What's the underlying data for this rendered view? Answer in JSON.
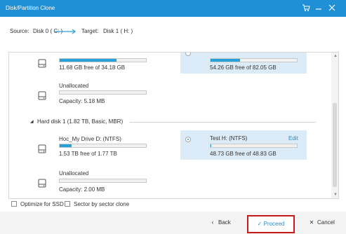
{
  "window": {
    "title": "Disk/Partition Clone",
    "controls": [
      "cart-icon",
      "minimize-icon",
      "close-icon"
    ]
  },
  "source_target": {
    "source_label": "Source:",
    "source_value": "Disk 0 ( C: )",
    "target_label": "Target:",
    "target_value": "Disk 1 ( H: )"
  },
  "disk0": {
    "partitions": [
      {
        "free_text": "11.68 GB free of 34.18 GB",
        "fill_pct": 66
      },
      {
        "name": "Unallocated",
        "capacity": "Capacity: 5.18 MB",
        "fill_pct": 0
      }
    ],
    "target_partial": {
      "free_text": "54.26 GB free of 82.05 GB",
      "fill_pct": 34
    }
  },
  "disk1": {
    "header": "Hard disk 1 (1.82 TB, Basic, MBR)",
    "partitions": [
      {
        "name": "Hoc_My Drive D: (NTFS)",
        "free_text": "1.53 TB free of 1.77 TB",
        "fill_pct": 14
      },
      {
        "name": "Unallocated",
        "capacity": "Capacity: 2.00 MB",
        "fill_pct": 0
      }
    ],
    "target": {
      "name": "Test H: (NTFS)",
      "edit": "Edit",
      "free_text": "48.73 GB free of 48.83 GB",
      "fill_pct": 1
    }
  },
  "options": {
    "optimize_ssd": "Optimize for SSD",
    "sector_clone": "Sector by sector clone"
  },
  "buttons": {
    "back": "Back",
    "proceed": "Proceed",
    "cancel": "Cancel"
  },
  "colors": {
    "title_bar": "#1f8fd6",
    "accent": "#27a2d9",
    "selected_bg": "#dbebf7",
    "highlight_border": "#c51a1a"
  }
}
